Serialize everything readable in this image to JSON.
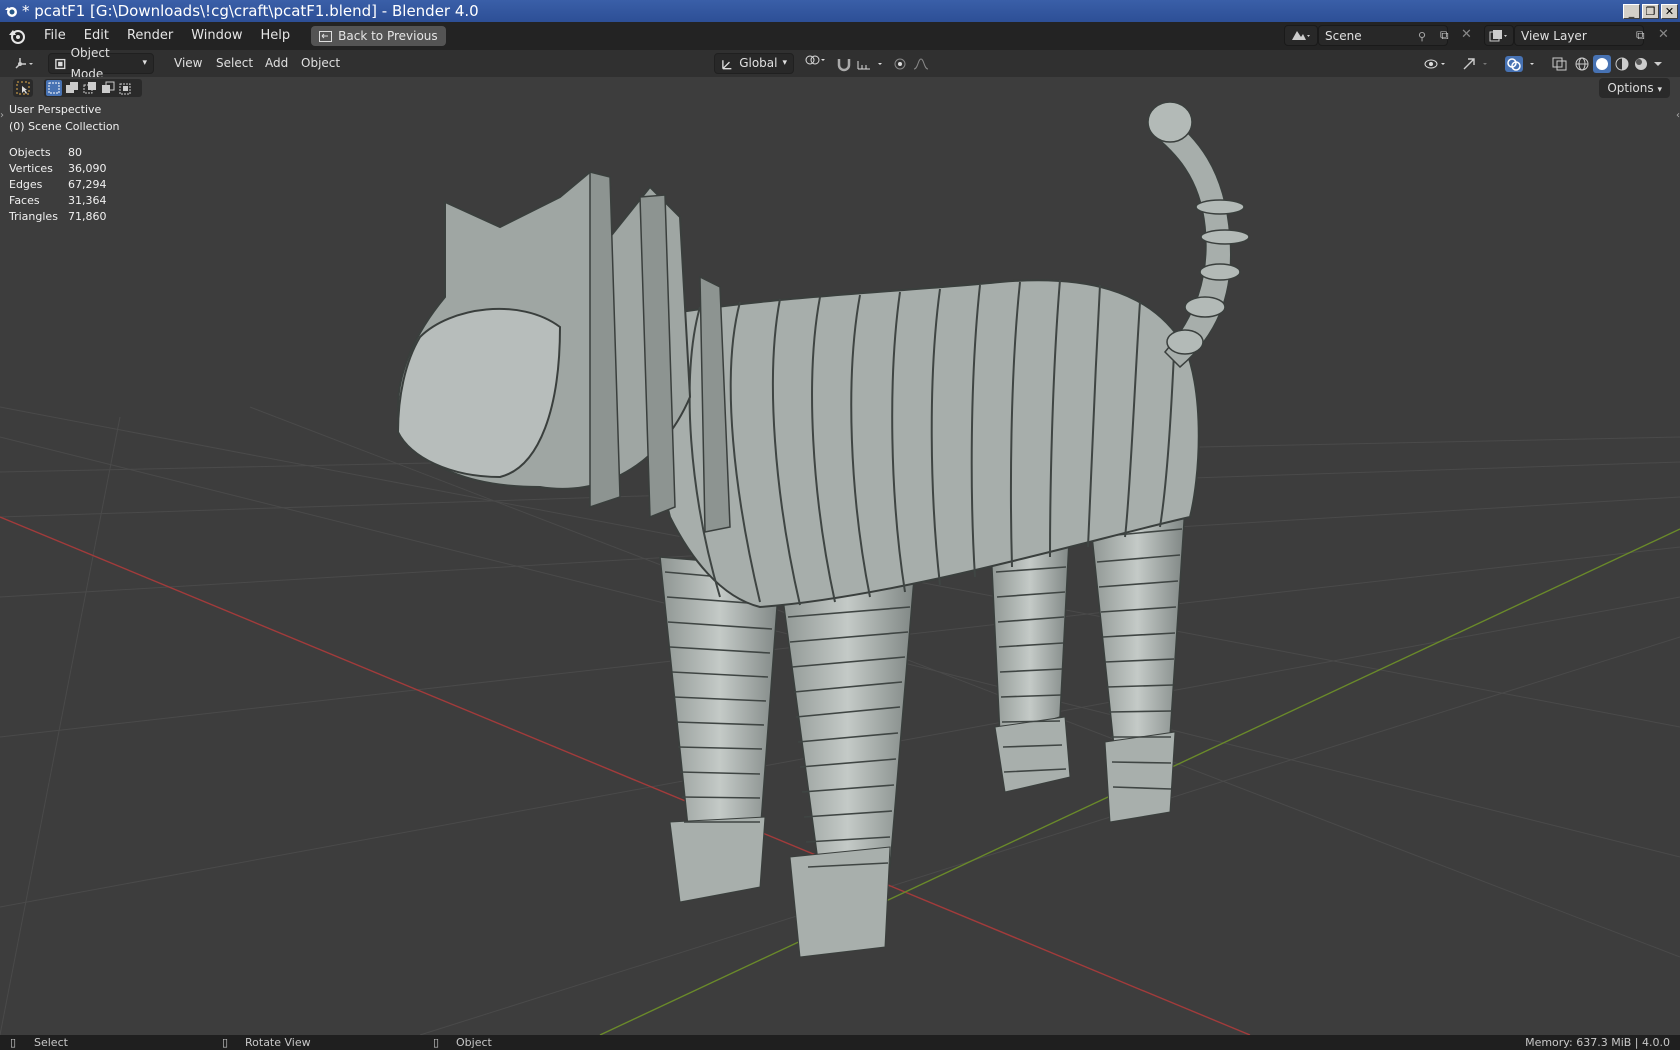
{
  "window": {
    "title": "* pcatF1 [G:\\Downloads\\!cg\\craft\\pcatF1.blend] - Blender 4.0",
    "controls": [
      "_",
      "❐",
      "✕"
    ]
  },
  "menubar": {
    "items": [
      "File",
      "Edit",
      "Render",
      "Window",
      "Help"
    ],
    "back_button": "Back to Previous",
    "scene": "Scene",
    "view_layer": "View Layer"
  },
  "header": {
    "mode": "Object Mode",
    "menus": [
      "View",
      "Select",
      "Add",
      "Object"
    ],
    "transform_orientation": "Global",
    "options_label": "Options"
  },
  "viewport": {
    "perspective": "User Perspective",
    "collection": "(0) Scene Collection",
    "stats": [
      {
        "label": "Objects",
        "value": "80"
      },
      {
        "label": "Vertices",
        "value": "36,090"
      },
      {
        "label": "Edges",
        "value": "67,294"
      },
      {
        "label": "Faces",
        "value": "31,364"
      },
      {
        "label": "Triangles",
        "value": "71,860"
      }
    ],
    "colors": {
      "background": "#3d3d3d",
      "x_axis": "#a23b3b",
      "y_axis": "#6a8a2a",
      "model": "#a7aeab"
    }
  },
  "statusbar": {
    "select": "Select",
    "rotate": "Rotate View",
    "object": "Object",
    "memory": "Memory: 637.3 MiB | 4.0.0"
  }
}
